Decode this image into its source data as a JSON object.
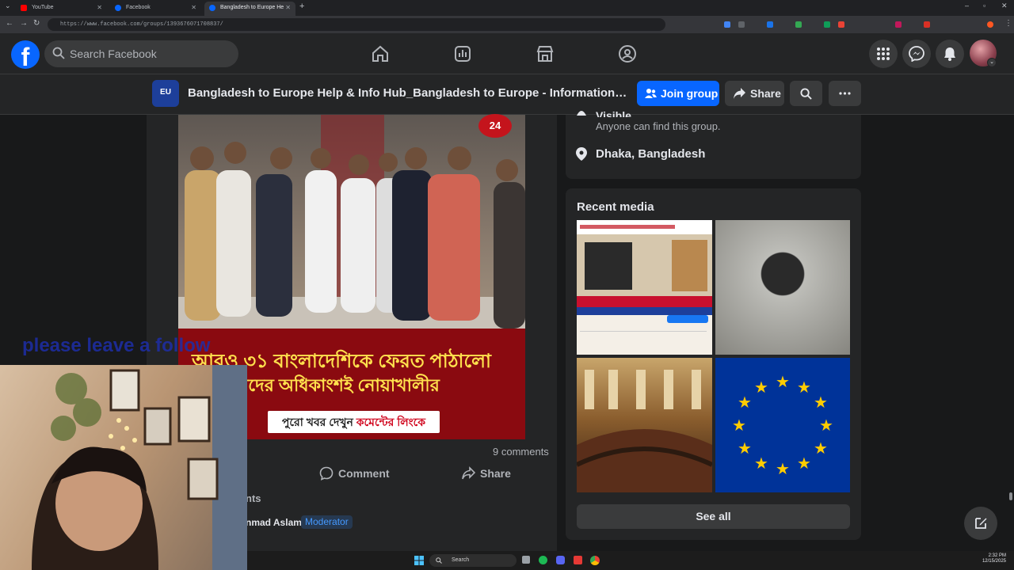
{
  "browser": {
    "tabs": [
      {
        "label": "YouTube",
        "favicon_color": "#ff0000",
        "active": false
      },
      {
        "label": "Facebook",
        "favicon_color": "#0866ff",
        "active": false
      },
      {
        "label": "Bangladesh to Europe Help & I",
        "favicon_color": "#0866ff",
        "active": true
      }
    ],
    "url": "https://www.facebook.com/groups/1393676071708837/"
  },
  "header": {
    "logo_letter": "f",
    "search_placeholder": "Search Facebook",
    "nav_icons": [
      "home-icon",
      "video-icon",
      "marketplace-icon",
      "groups-icon"
    ],
    "right_icons": [
      "menu-grid-icon",
      "messenger-icon",
      "bell-icon"
    ]
  },
  "group": {
    "thumb_text": "EU",
    "title": "Bangladesh to Europe Help & Info Hub_Bangladesh to Europe - Information an...",
    "join_label": "Join group",
    "share_label": "Share"
  },
  "post": {
    "channel_logo": "24",
    "banner_line1": "আরও ৩১ বাংলাদেশিকে ফেরত পাঠালো",
    "banner_line2": "ষ্ট্র, যাদের অধিকাংশই নোয়াখালীর",
    "banner_button_text": "পুরো খবর দেখুন ",
    "banner_button_highlight": "কমেন্টের লিংকে",
    "comment_count": "9 comments",
    "comment_label": "Comment",
    "share_label": "Share",
    "comments_section_label": "nts",
    "commenter_name": "nmad Aslam",
    "commenter_badge": "Moderator"
  },
  "sidebar": {
    "visible_title": "Visible",
    "visible_desc": "Anyone can find this group.",
    "location": "Dhaka, Bangladesh",
    "media_title": "Recent media",
    "see_all": "See all"
  },
  "overlay": {
    "text": "please leave a follow"
  },
  "taskbar": {
    "search_label": "Search",
    "time": "2:32 PM",
    "date": "12/15/2025"
  },
  "colors": {
    "fb_blue": "#0866ff",
    "card_bg": "#242526",
    "page_bg": "#18191a"
  }
}
